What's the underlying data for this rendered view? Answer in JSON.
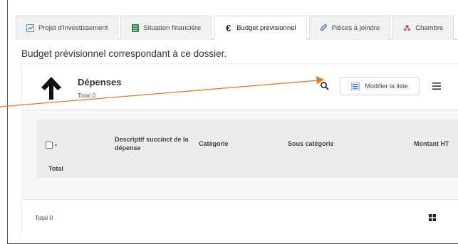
{
  "tabs": [
    {
      "label": "Projet d'investissement",
      "icon": "line-chart-icon",
      "active": false
    },
    {
      "label": "Situation financière",
      "icon": "spreadsheet-icon",
      "active": false
    },
    {
      "label": "Budget prévisionnel",
      "icon": "euro-icon",
      "active": true
    },
    {
      "label": "Pièces à joindre",
      "icon": "paperclip-icon",
      "active": false
    },
    {
      "label": "Chambre",
      "icon": "people-icon",
      "active": false
    }
  ],
  "intro_text": "Budget prévisionnel correspondant à ce dossier.",
  "section": {
    "title": "Dépenses",
    "total_text": "Total 0",
    "modify_label": "Modifier la liste"
  },
  "table": {
    "columns": [
      "Descriptif succinct de la dépense",
      "Catégorie",
      "Sous catégorie",
      "Montant HT"
    ],
    "total_label": "Total"
  },
  "footer": {
    "total_text": "Total 0"
  },
  "colors": {
    "accent_blue": "#3a78c8",
    "annotation_arrow": "#e07a2a",
    "panel_background": "#f7f7f7"
  }
}
